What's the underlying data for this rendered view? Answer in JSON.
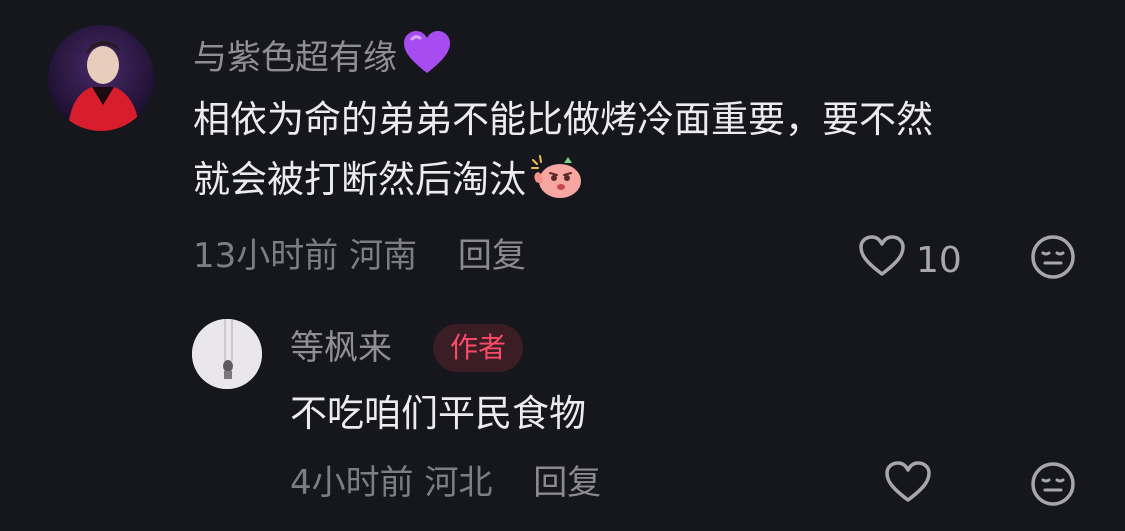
{
  "comments": [
    {
      "username": "与紫色超有缘",
      "username_emoji": "purple-heart",
      "text_line1": "相依为命的弟弟不能比做烤冷面重要，要不然",
      "text_line2": "就会被打断然后淘汰",
      "sticker": "angry-face-sticker",
      "time": "13小时前",
      "location": "河南",
      "reply_label": "回复",
      "likes": "10"
    },
    {
      "username": "等枫来",
      "badge": "作者",
      "text": "不吃咱们平民食物",
      "time": "4小时前",
      "location": "河北",
      "reply_label": "回复"
    }
  ],
  "colors": {
    "background": "#16161d",
    "author_badge": "#fb4b66",
    "username": "#8e8e94",
    "purple_heart": "#a64cf0"
  }
}
